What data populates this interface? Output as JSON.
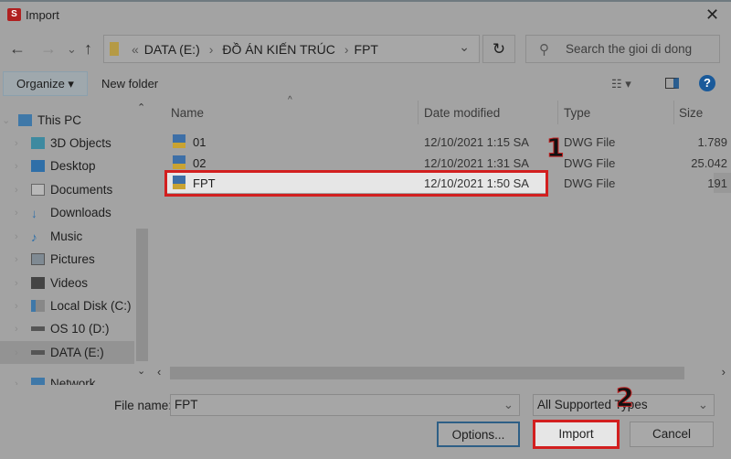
{
  "window": {
    "title": "Import",
    "close": "✕"
  },
  "nav": {
    "back": "←",
    "forward": "→",
    "recent": "⌄",
    "up": "↑"
  },
  "address": {
    "overflow": "«",
    "crumbs": [
      "DATA (E:)",
      "ĐỒ ÁN KIẾN TRÚC",
      "FPT"
    ],
    "sep": "›",
    "dropdown": "⌄",
    "refresh": "↻"
  },
  "search": {
    "placeholder": "Search the gioi di dong",
    "icon": "⚲"
  },
  "toolbar": {
    "organize": "Organize ▾",
    "new_folder": "New folder",
    "view": "☷ ▾",
    "help": "?"
  },
  "sidebar": {
    "items": [
      {
        "label": "This PC",
        "icon": "pc-icon"
      },
      {
        "label": "3D Objects",
        "icon": "cube-icon"
      },
      {
        "label": "Desktop",
        "icon": "desktop-icon"
      },
      {
        "label": "Documents",
        "icon": "document-icon"
      },
      {
        "label": "Downloads",
        "icon": "download-icon"
      },
      {
        "label": "Music",
        "icon": "music-icon"
      },
      {
        "label": "Pictures",
        "icon": "picture-icon"
      },
      {
        "label": "Videos",
        "icon": "video-icon"
      },
      {
        "label": "Local Disk (C:)",
        "icon": "drive-icon"
      },
      {
        "label": "OS 10 (D:)",
        "icon": "drive-icon"
      },
      {
        "label": "DATA (E:)",
        "icon": "drive-icon"
      },
      {
        "label": "Network",
        "icon": "network-icon"
      }
    ]
  },
  "columns": {
    "name": "Name",
    "date": "Date modified",
    "type": "Type",
    "size": "Size"
  },
  "files": [
    {
      "name": "01",
      "date": "12/10/2021 1:15 SA",
      "type": "DWG File",
      "size": "1.789"
    },
    {
      "name": "02",
      "date": "12/10/2021 1:31 SA",
      "type": "DWG File",
      "size": "25.042"
    },
    {
      "name": "FPT",
      "date": "12/10/2021 1:50 SA",
      "type": "DWG File",
      "size": "191"
    }
  ],
  "annotations": {
    "step1": "1",
    "step2": "2"
  },
  "bottom": {
    "file_name_label": "File name:",
    "file_name": "FPT",
    "file_type": "All Supported Types",
    "options": "Options...",
    "import": "Import",
    "cancel": "Cancel"
  },
  "colors": {
    "highlight": "#d21f1f",
    "help": "#1a5a9a"
  }
}
